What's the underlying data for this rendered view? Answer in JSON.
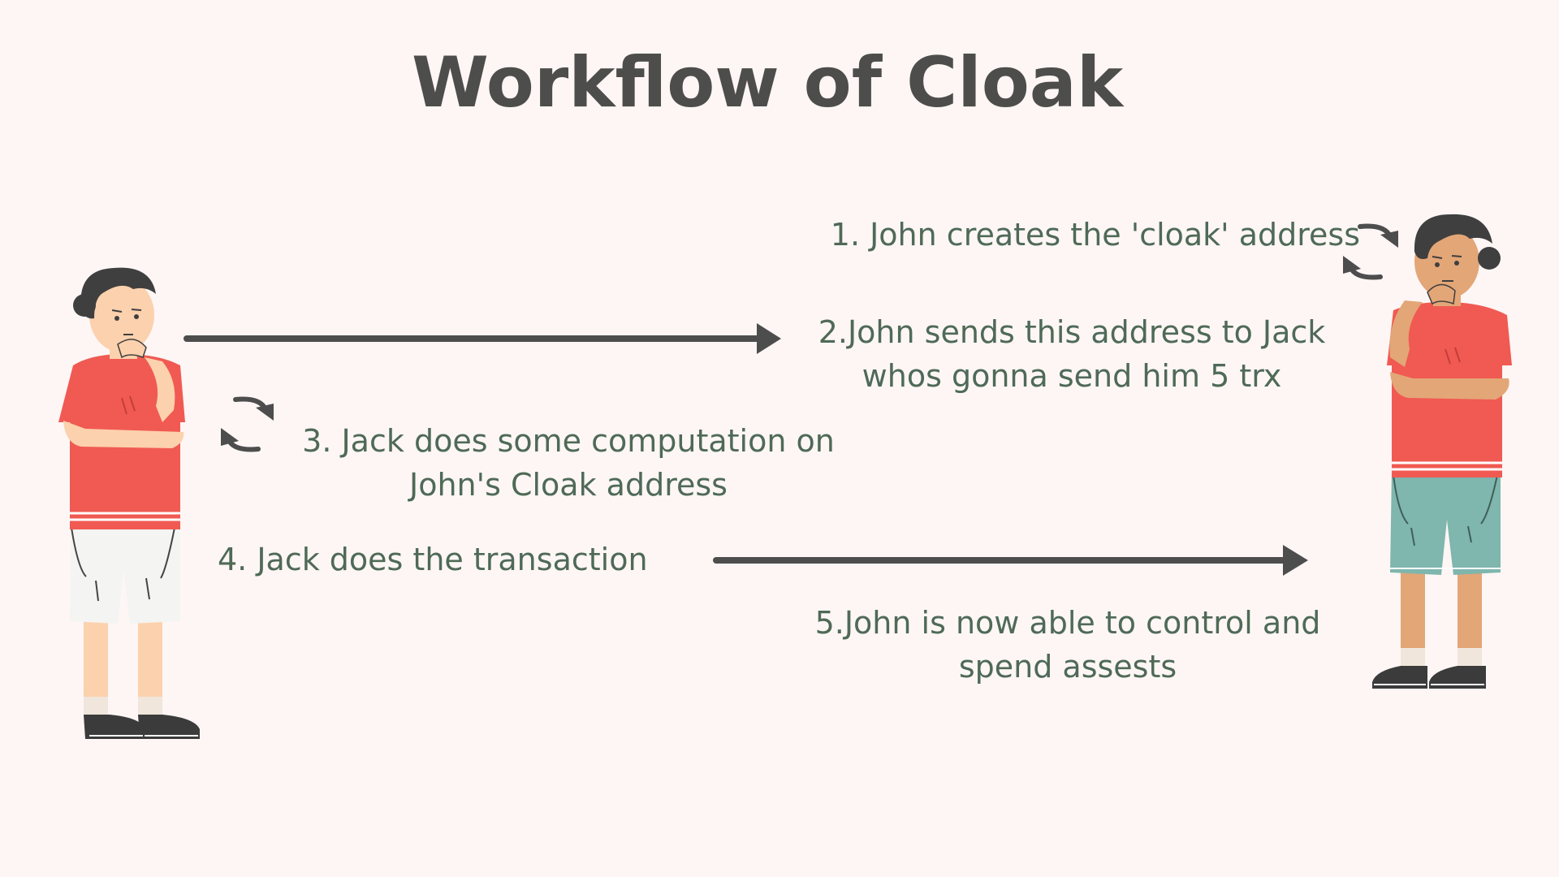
{
  "title": "Workflow of Cloak",
  "steps": {
    "step1": {
      "lines": [
        "1. John creates the 'cloak' address"
      ]
    },
    "step2": {
      "lines": [
        "2.John sends this address to Jack",
        "whos gonna send him  5 trx"
      ]
    },
    "step3": {
      "lines": [
        "3. Jack does some computation on",
        "John's Cloak address"
      ]
    },
    "step4": {
      "lines": [
        "4. Jack does the transaction"
      ]
    },
    "step5": {
      "lines": [
        "5.John is now able to control and",
        "spend assests"
      ]
    }
  },
  "colors": {
    "background": "#fdf6f5",
    "title": "#4d4d4b",
    "step_text": "#4f6a57",
    "arrow": "#4d4d4d",
    "shirt": "#f05a52",
    "skin_light": "#fcd1ad",
    "skin_tan": "#e3a677",
    "hair": "#3f3f3f",
    "shorts_white": "#f4f4f2",
    "shorts_teal": "#7fb6ad",
    "shoes": "#3b3b3b"
  },
  "icons": [
    "person-jack-icon",
    "person-john-icon",
    "cycle-arrows-icon",
    "arrow-right-icon"
  ]
}
